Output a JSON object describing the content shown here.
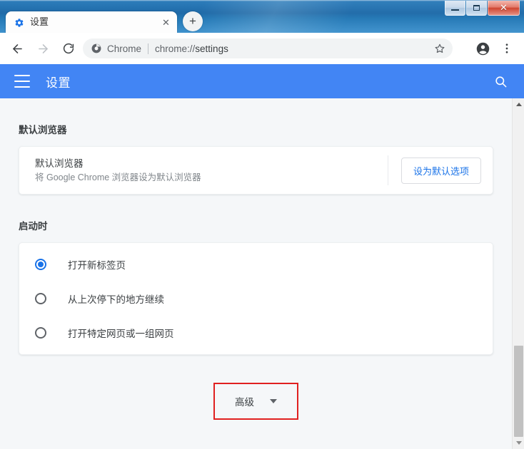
{
  "window": {
    "controls": {
      "minimize_label": "Minimize",
      "maximize_label": "Maximize",
      "close_label": "✕"
    }
  },
  "tabstrip": {
    "tabs": [
      {
        "title": "设置",
        "favicon": "gear-icon",
        "close_label": "✕"
      }
    ],
    "new_tab_label": "+"
  },
  "toolbar": {
    "back_label": "Back",
    "forward_label": "Forward",
    "reload_label": "Reload",
    "omnibox": {
      "security_icon": "chrome-logo-icon",
      "chip_label": "Chrome",
      "separator": "|",
      "url_scheme": "chrome://",
      "url_path": "settings",
      "full_url": "chrome://settings"
    },
    "bookmark_label": "Bookmark this tab",
    "profile_label": "Profile",
    "menu_label": "Customize and control Google Chrome"
  },
  "settings_header": {
    "menu_icon": "hamburger-icon",
    "title": "设置",
    "search_icon": "search-icon"
  },
  "content": {
    "default_browser": {
      "section_label": "默认浏览器",
      "card_title": "默认浏览器",
      "card_subtitle": "将 Google Chrome 浏览器设为默认浏览器",
      "button_label": "设为默认选项"
    },
    "on_startup": {
      "section_label": "启动时",
      "options": [
        {
          "label": "打开新标签页",
          "selected": true
        },
        {
          "label": "从上次停下的地方继续",
          "selected": false
        },
        {
          "label": "打开特定网页或一组网页",
          "selected": false
        }
      ]
    },
    "advanced": {
      "label": "高级",
      "chevron_icon": "chevron-down-icon",
      "highlight_color": "#e02020"
    }
  },
  "scrollbar": {
    "up_arrow": "triangle-up-icon",
    "down_arrow": "triangle-down-icon"
  },
  "colors": {
    "titlebar_blue": "#2277b5",
    "settings_header_blue": "#4285f4",
    "accent_blue": "#1a73e8",
    "page_background": "#f5f7f9",
    "annotation_red": "#e02020"
  }
}
